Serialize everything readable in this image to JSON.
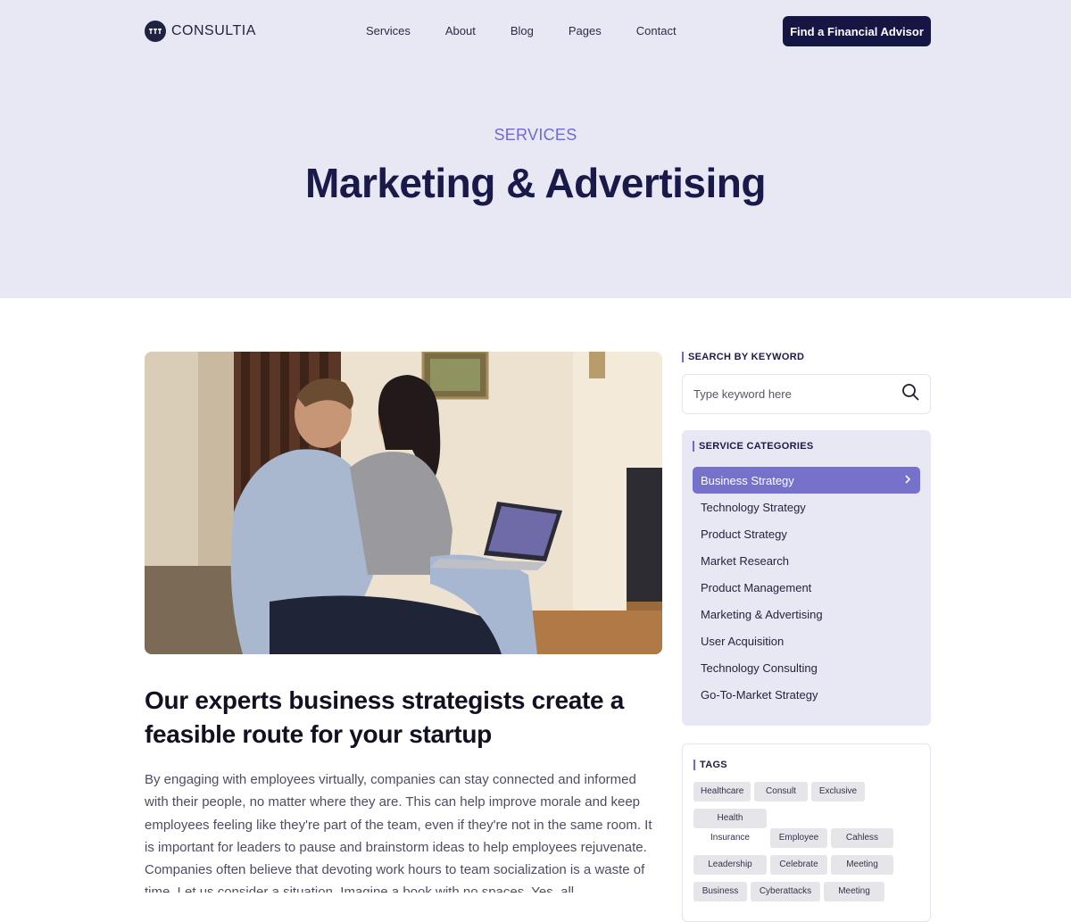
{
  "brand": {
    "name": "CONSULTIA"
  },
  "nav": {
    "items": [
      "Services",
      "About",
      "Blog",
      "Pages",
      "Contact"
    ],
    "cta": "Find a Financial Advisor"
  },
  "hero": {
    "eyebrow": "SERVICES",
    "title": "Marketing & Advertising"
  },
  "article": {
    "image_alt": "Man and woman reviewing a laptop together at home",
    "heading": "Our experts business strategists create a feasible route for your startup",
    "body": "By engaging with employees virtually, companies can stay connected and informed with their people, no matter where they are. This can help improve morale and keep employees feeling like they're part of the team, even if they're not in the same room. It is important for leaders to pause and brainstorm ideas to help employees rejuvenate. Companies often believe that devoting work hours to team socialization is a waste of time. Let us consider a situation. Imagine a book with no spaces. Yes, all"
  },
  "sidebar": {
    "search": {
      "label": "SEARCH BY KEYWORD",
      "placeholder": "Type keyword here"
    },
    "categories": {
      "label": "SERVICE CATEGORIES",
      "items": [
        "Business Strategy",
        "Technology Strategy",
        "Product Strategy",
        "Market Research",
        "Product Management",
        "Marketing & Advertising",
        "User Acquisition",
        "Technology Consulting",
        "Go-To-Market Strategy"
      ],
      "active_index": 0
    },
    "tags": {
      "label": "TAGS",
      "items": [
        "Healthcare",
        "Consult",
        "Exclusive",
        "Health Insurance",
        "Employee",
        "Cahless",
        "Leadership",
        "Celebrate",
        "Meeting",
        "Business",
        "Cyberattacks",
        "Meeting"
      ]
    }
  },
  "colors": {
    "hero_bg": "#e8e8f4",
    "primary_dark": "#161645",
    "accent": "#7672cc",
    "eyebrow": "#6e6ad1"
  }
}
